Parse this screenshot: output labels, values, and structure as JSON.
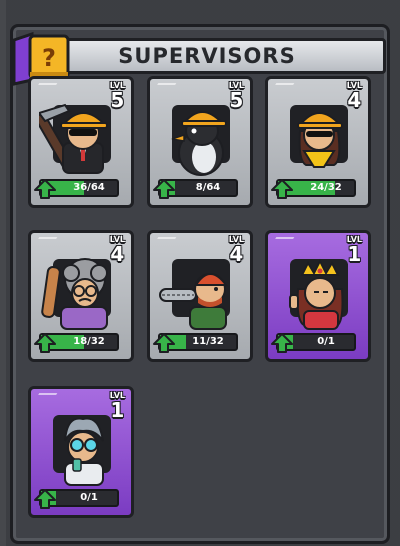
{
  "header": {
    "title": "SUPERVISORS",
    "book_badge": "?"
  },
  "cards": [
    {
      "level_label": "LVL",
      "level": "5",
      "progress_text": "36/64",
      "progress": 0.5625,
      "rarity": "common",
      "character": "hardhat-worker-with-pickaxe"
    },
    {
      "level_label": "LVL",
      "level": "5",
      "progress_text": "8/64",
      "progress": 0.125,
      "rarity": "common",
      "character": "penguin-with-hardhat"
    },
    {
      "level_label": "LVL",
      "level": "4",
      "progress_text": "24/32",
      "progress": 0.75,
      "rarity": "common",
      "character": "woman-with-hardhat"
    },
    {
      "level_label": "LVL",
      "level": "4",
      "progress_text": "18/32",
      "progress": 0.5625,
      "rarity": "common",
      "character": "grandma-with-rolling-pin"
    },
    {
      "level_label": "LVL",
      "level": "4",
      "progress_text": "11/32",
      "progress": 0.34375,
      "rarity": "common",
      "character": "lumberjack-with-chainsaw"
    },
    {
      "level_label": "LVL",
      "level": "1",
      "progress_text": "0/1",
      "progress": 0,
      "rarity": "epic",
      "character": "queen-with-crown"
    },
    {
      "level_label": "LVL",
      "level": "1",
      "progress_text": "0/1",
      "progress": 0,
      "rarity": "epic",
      "character": "scientist-with-goggles"
    }
  ],
  "colors": {
    "progress_fill": "#38b449",
    "common_card": "#b8bbc0",
    "epic_card": "#8f4fd2",
    "book_purple": "#7f3fd1",
    "book_yellow": "#f4b626"
  }
}
